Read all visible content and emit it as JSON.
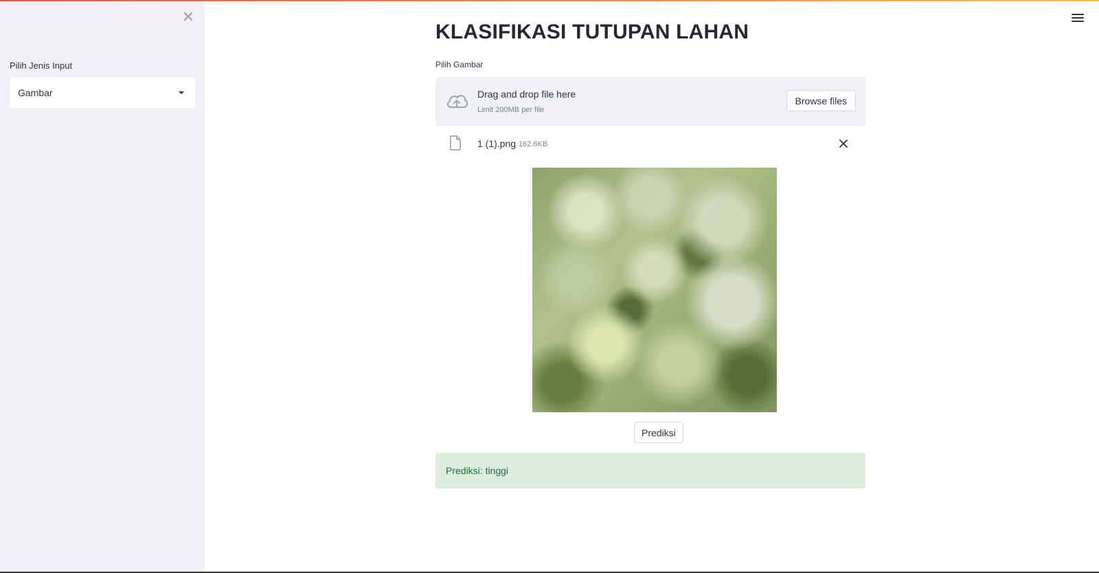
{
  "sidebar": {
    "close_icon": "close-icon",
    "input_type_label": "Pilih Jenis Input",
    "input_type_value": "Gambar"
  },
  "header": {
    "menu_icon": "hamburger-menu-icon"
  },
  "main": {
    "title": "KLASIFIKASI TUTUPAN LAHAN",
    "uploader": {
      "label": "Pilih Gambar",
      "drop_text": "Drag and drop file here",
      "limit_text": "Limit 200MB per file",
      "browse_label": "Browse files",
      "icon": "cloud-upload-icon"
    },
    "uploaded_file": {
      "name": "1 (1).png",
      "size": "162.6KB",
      "icon": "file-icon",
      "remove_icon": "close-icon"
    },
    "predict_button": "Prediksi",
    "result_text": "Prediksi: tinggi"
  },
  "colors": {
    "sidebar_bg": "#f0f2f6",
    "success_bg": "#dcefdc",
    "success_text": "#1e6b33",
    "accent_gradient_start": "#ff4b4b",
    "accent_gradient_end": "#ffbd45"
  }
}
